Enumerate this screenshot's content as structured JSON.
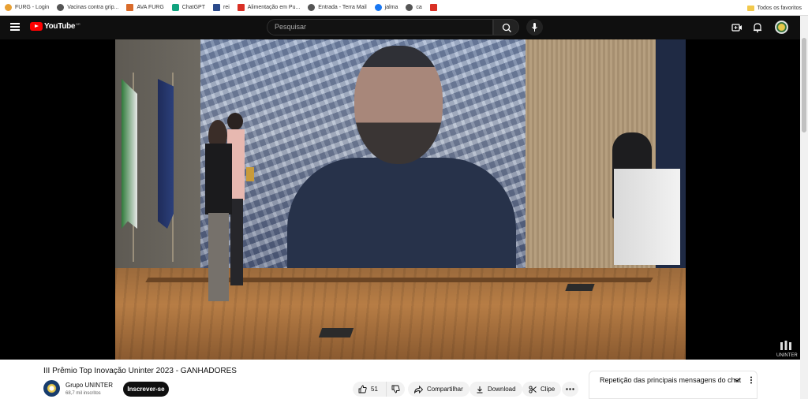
{
  "bookmarks": [
    {
      "label": "FURG - Login",
      "color": "#e8a033"
    },
    {
      "label": "Vacinas contra grip...",
      "color": "#555555"
    },
    {
      "label": "AVA FURG",
      "color": "#d96b2b"
    },
    {
      "label": "ChatGPT",
      "color": "#10a37f"
    },
    {
      "label": "rei",
      "color": "#2b4a8b"
    },
    {
      "label": "Alimentação em Pu...",
      "color": "#d93025"
    },
    {
      "label": "Entrada - Terra Mail",
      "color": "#555555"
    },
    {
      "label": "jalma",
      "color": "#1877f2"
    },
    {
      "label": "ca",
      "color": "#555555"
    },
    {
      "label": "",
      "color": "#d93025"
    }
  ],
  "bookmarks_right": {
    "label": "Todos os favoritos"
  },
  "header": {
    "logo_text": "YouTube",
    "country_code": "BR",
    "search_placeholder": "Pesquisar"
  },
  "video": {
    "brand_mark": "UNINTER"
  },
  "info": {
    "title": "III Prêmio Top Inovação Uninter 2023 - GANHADORES",
    "channel_name": "Grupo UNINTER",
    "subscribers": "68,7 mil inscritos",
    "subscribe_label": "Inscrever-se",
    "like_count": "51",
    "share_label": "Compartilhar",
    "download_label": "Download",
    "clip_label": "Clipe"
  },
  "chat": {
    "title": "Repetição das principais mensagens do chat"
  },
  "colors": {
    "header_bg": "#0f0f0f",
    "accent_red": "#ff0000",
    "pill_bg": "#f2f2f2"
  }
}
